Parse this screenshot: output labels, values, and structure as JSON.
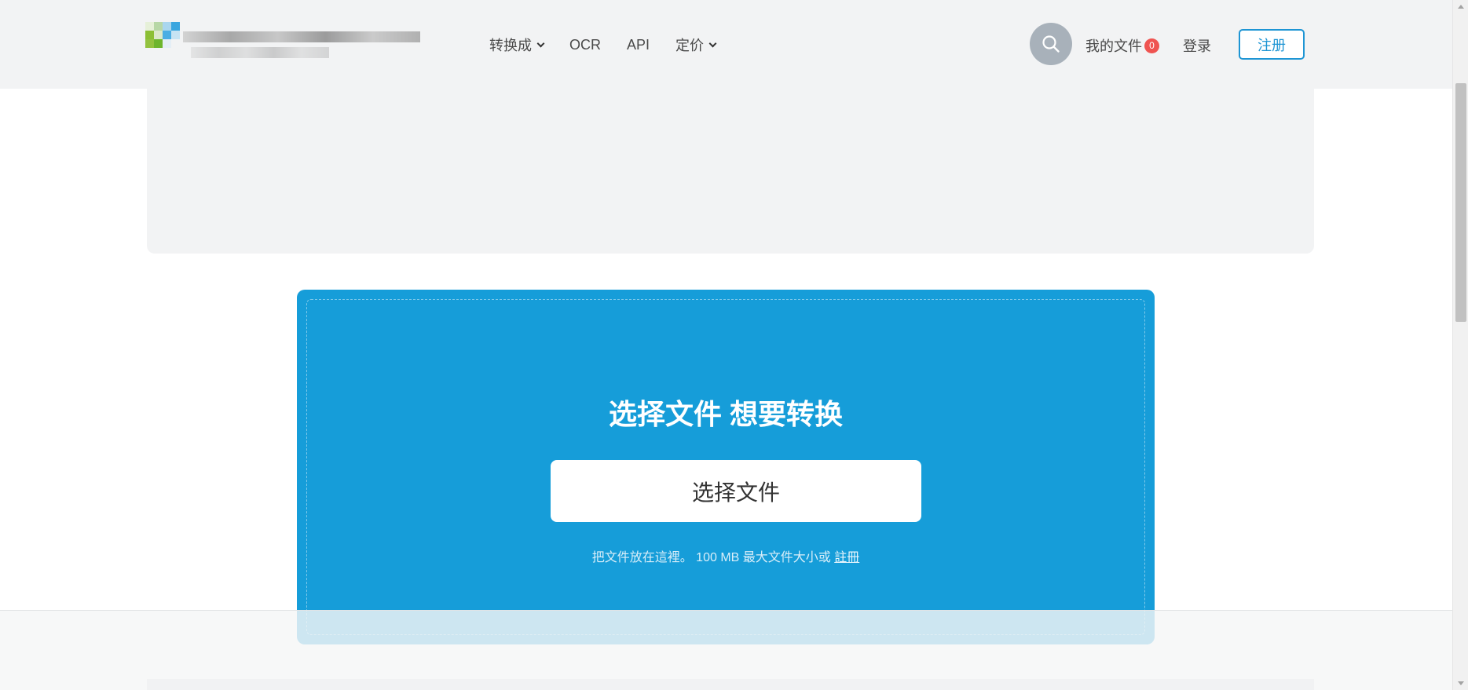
{
  "header": {
    "nav": {
      "convert_label": "转换成",
      "ocr_label": "OCR",
      "api_label": "API",
      "pricing_label": "定价"
    },
    "search_icon": "search-icon",
    "my_files_label": "我的文件",
    "my_files_count": "0",
    "login_label": "登录",
    "register_label": "注册"
  },
  "upload": {
    "title": "选择文件 想要转换",
    "choose_button_label": "选择文件",
    "hint_text": "把文件放在這裡。 100 MB 最大文件大小或",
    "hint_link": "註冊"
  },
  "colors": {
    "accent": "#1e95d4",
    "upload_panel": "#169dd9",
    "badge": "#ef5350",
    "header_bg": "#f2f3f4"
  }
}
